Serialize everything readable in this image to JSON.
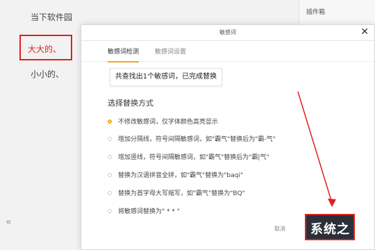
{
  "background": {
    "lines": [
      "当下软件园",
      "大大的、",
      "小小的、"
    ],
    "right_panel_title": "插件箱",
    "collapse_icon": "double-chevron-left-icon"
  },
  "dialog": {
    "title": "敏感词",
    "tabs": [
      {
        "label": "敏感词检测",
        "active": true
      },
      {
        "label": "敏感词设置",
        "active": false
      }
    ],
    "result_text": "共查找出1个敏感词，已完成替换",
    "section_title": "选择替换方式",
    "options": [
      {
        "label": "不修改敏感词，仅字体颜色高亮显示",
        "selected": true
      },
      {
        "label": "增加分隔线，符号间隔敏感词，如\"霸气\"替换后为\"霸-气\"",
        "selected": false
      },
      {
        "label": "增加竖线，符号间隔敏感词，如\"霸气\"替换后为\"霸|气\"",
        "selected": false
      },
      {
        "label": "替换为汉语拼音全拼，如\"霸气\"替换为\"baqi\"",
        "selected": false
      },
      {
        "label": "替换为首字母大写缩写，如\"霸气\"替换为\"BQ\"",
        "selected": false
      },
      {
        "label": "将敏感词替换为\" * * \"",
        "selected": false
      }
    ],
    "cancel_label": "取消",
    "watermark_text": "系统之"
  },
  "colors": {
    "accent": "#f0a91a",
    "highlight_box": "#e0201b"
  }
}
